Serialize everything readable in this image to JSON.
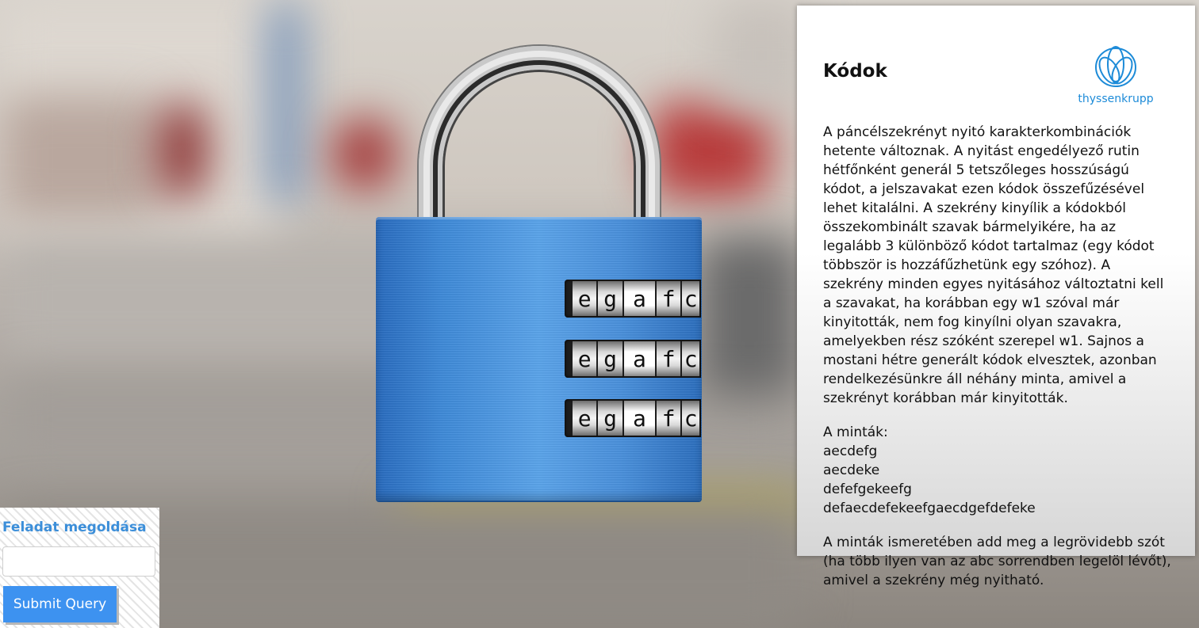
{
  "lock": {
    "dials": [
      [
        "e",
        "g",
        "a",
        "f",
        "c"
      ],
      [
        "e",
        "g",
        "a",
        "f",
        "c"
      ],
      [
        "e",
        "g",
        "a",
        "f",
        "c"
      ]
    ],
    "body_color": "#3f8ad8"
  },
  "panel": {
    "title": "Kódok",
    "logo_text": "thyssenkrupp",
    "paragraph1": "A páncélszekrényt nyitó karakterkombinációk hetente változnak. A nyitást engedélyező rutin hétfőnként generál 5 tetszőleges hosszúságú kódot, a jelszavakat ezen kódok összefűzésével lehet kitalálni. A szekrény kinyílik a kódokból összekombinált szavak bármelyikére, ha az legalább 3 különböző kódot tartalmaz (egy kódot többször is hozzáfűzhetünk egy szóhoz). A szekrény minden egyes nyitásához változtatni kell a szavakat, ha korábban egy w1 szóval már kinyitották, nem fog kinyílni olyan szavakra, amelyekben rész szóként szerepel w1. Sajnos a mostani hétre generált kódok elvesztek, azonban rendelkezésünkre áll néhány minta, amivel a szekrényt korábban már kinyitották.",
    "samples_label": "A minták:",
    "samples": [
      "aecdefg",
      "aecdeke",
      "defefgekeefg",
      "defaecdefekeefgaecdgefdefeke"
    ],
    "paragraph3": "A minták ismeretében add meg a legrövidebb szót (ha több ilyen van az abc sorrendben legelöl lévőt), amivel a szekrény még nyitható."
  },
  "answer": {
    "label": "Feladat megoldása",
    "input_value": "",
    "submit_label": "Submit Query"
  },
  "colors": {
    "accent": "#3d92f0",
    "label": "#3b8ed9",
    "logo": "#1d8bd8"
  }
}
